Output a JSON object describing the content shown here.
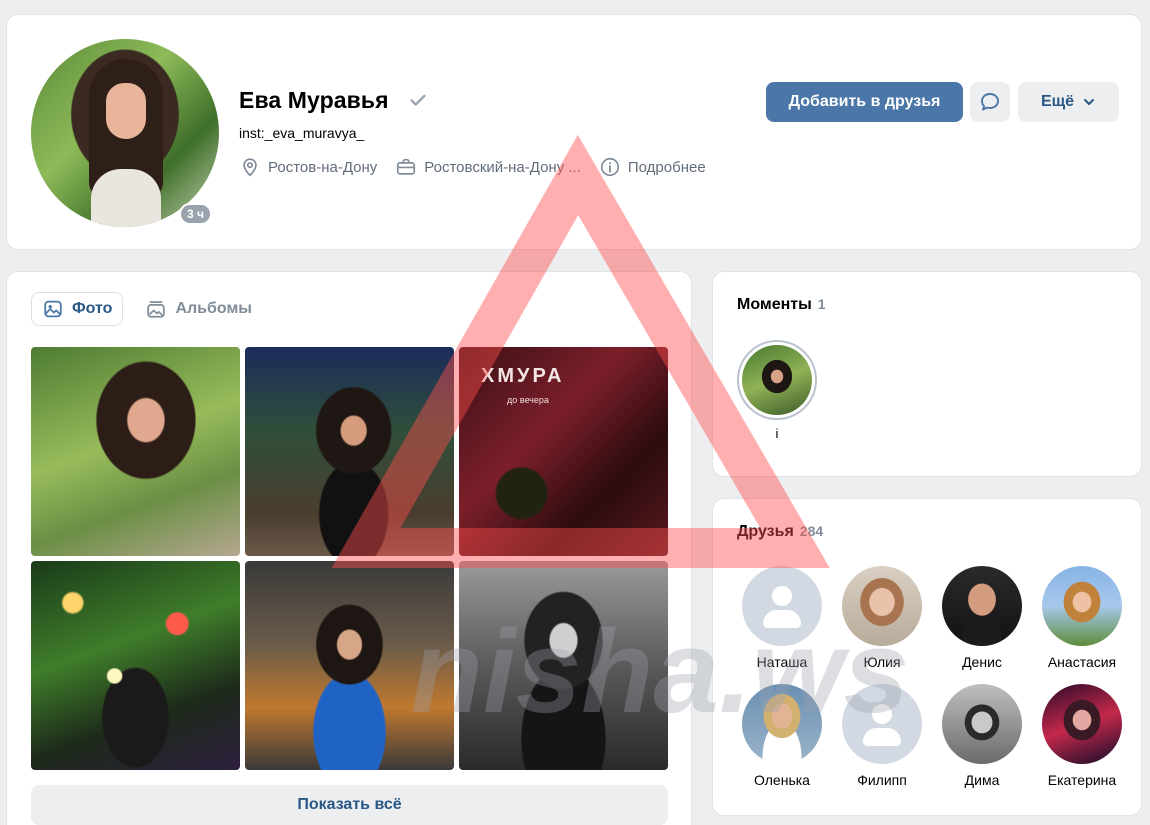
{
  "profile": {
    "name": "Ева Муравья",
    "status": "inst:_eva_muravya_",
    "last_seen_badge": "3 ч",
    "city": "Ростов-на-Дону",
    "work": "Ростовский-на-Дону ...",
    "details_label": "Подробнее",
    "add_friend_label": "Добавить в друзья",
    "more_label": "Ещё",
    "verified": true
  },
  "photos": {
    "tabs": [
      {
        "label": "Фото",
        "active": true,
        "icon": "image-icon"
      },
      {
        "label": "Альбомы",
        "active": false,
        "icon": "albums-icon"
      }
    ],
    "show_all_label": "Показать всё",
    "sign_text": "ХМУРА",
    "sign_sub": "до вечера"
  },
  "moments": {
    "title": "Моменты",
    "count": "1",
    "items": [
      {
        "label": "i"
      }
    ]
  },
  "friends": {
    "title": "Друзья",
    "count": "284",
    "items": [
      {
        "name": "Наташа"
      },
      {
        "name": "Юлия"
      },
      {
        "name": "Денис"
      },
      {
        "name": "Анастасия"
      },
      {
        "name": "Оленька"
      },
      {
        "name": "Филипп"
      },
      {
        "name": "Дима"
      },
      {
        "name": "Екатерина"
      }
    ]
  },
  "watermark": {
    "text": "nisha.ws",
    "colors": {
      "triangle": "#ff4d4d",
      "text": "#9aa0a8"
    }
  },
  "colors": {
    "background": "#edeef0",
    "primary": "#4a76a8",
    "link": "#2a5885",
    "muted": "#818c99"
  }
}
